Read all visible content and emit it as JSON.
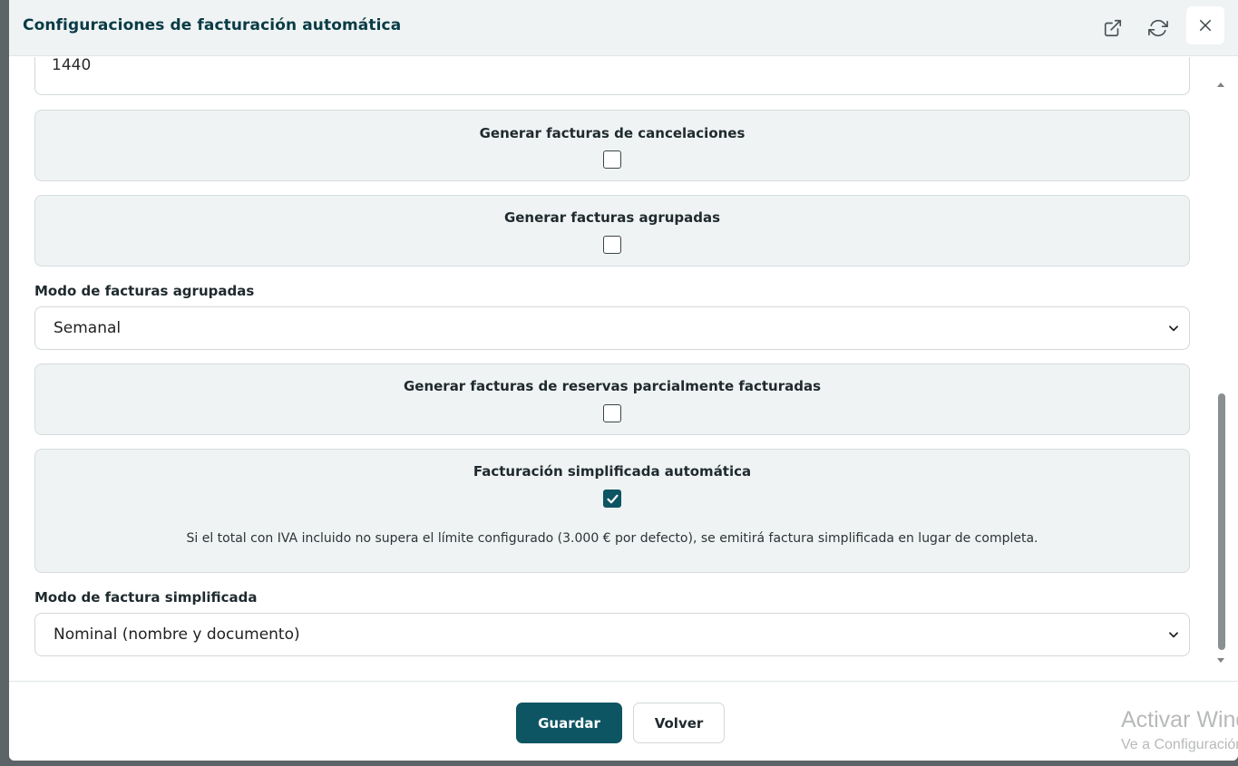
{
  "header": {
    "title": "Configuraciones de facturación automática",
    "open_icon": "external-link-icon",
    "refresh_icon": "refresh-icon",
    "close_icon": "close-icon"
  },
  "form": {
    "top_input_value": "1440",
    "cancel_invoices": {
      "label": "Generar facturas de cancelaciones",
      "checked": false
    },
    "grouped_invoices": {
      "label": "Generar facturas agrupadas",
      "checked": false
    },
    "grouped_mode": {
      "label": "Modo de facturas agrupadas",
      "value": "Semanal"
    },
    "partial_invoices": {
      "label": "Generar facturas de reservas parcialmente facturadas",
      "checked": false
    },
    "simplified_auto": {
      "label": "Facturación simplificada automática",
      "checked": true,
      "help": "Si el total con IVA incluido no supera el límite configurado (3.000 € por defecto), se emitirá factura simplificada en lugar de completa."
    },
    "simplified_mode": {
      "label": "Modo de factura simplificada",
      "value": "Nominal (nombre y documento)"
    }
  },
  "footer": {
    "save_label": "Guardar",
    "back_label": "Volver"
  },
  "watermark": {
    "line1": "Activar Windows",
    "line2": "Ve a Configuración para activar Windows."
  },
  "colors": {
    "primary": "#0e5563",
    "title": "#083b45",
    "card_bg": "#eff3f3"
  }
}
